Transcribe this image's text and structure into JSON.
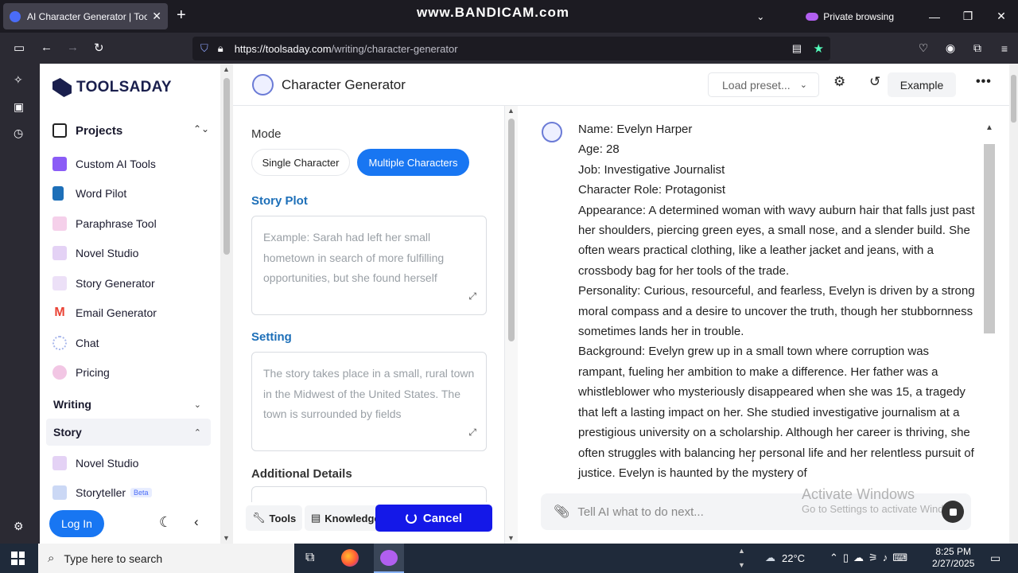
{
  "browser": {
    "tab_title": "AI Character Generator | Toolsaday",
    "tab_close": "✕",
    "new_tab": "+",
    "watermark": "www.BANDICAM.com",
    "private_label": "Private browsing",
    "url_host": "https://toolsaday.com",
    "url_path": "/writing/character-generator"
  },
  "sidebar": {
    "logo": "TOOLSADAY",
    "projects": "Projects",
    "items": [
      {
        "label": "Custom AI Tools",
        "color": "#8b5cf6"
      },
      {
        "label": "Word Pilot",
        "color": "#1d6fb8"
      },
      {
        "label": "Paraphrase Tool",
        "color": "#e9a8d8"
      },
      {
        "label": "Novel Studio",
        "color": "#c4a3e8"
      },
      {
        "label": "Story Generator",
        "color": "#d9c4f0"
      },
      {
        "label": "Email Generator",
        "color": "#ea4335"
      },
      {
        "label": "Chat",
        "color": "#b8c8f0"
      },
      {
        "label": "Pricing",
        "color": "#e58fc6"
      }
    ],
    "section_writing": "Writing",
    "section_story": "Story",
    "story_items": [
      {
        "label": "Novel Studio"
      },
      {
        "label": "Storyteller",
        "badge": "Beta"
      }
    ],
    "login": "Log In"
  },
  "header": {
    "title": "Character Generator",
    "preset": "Load preset...",
    "example": "Example"
  },
  "form": {
    "mode_label": "Mode",
    "mode_single": "Single Character",
    "mode_multiple": "Multiple Characters",
    "mode_selected": "Multiple Characters",
    "plot_label": "Story Plot",
    "plot_placeholder": "Example: Sarah had left her small hometown in search of more fulfilling opportunities, but she found herself",
    "setting_label": "Setting",
    "setting_placeholder": "The story takes place in a small, rural town in the Midwest of the United States. The town is surrounded by fields",
    "details_label": "Additional Details",
    "tools_btn": "Tools",
    "knowledge_btn": "Knowledge",
    "cancel_btn": "Cancel"
  },
  "output": {
    "lines": [
      "Name: Evelyn Harper",
      "Age: 28",
      "Job: Investigative Journalist",
      "Character Role: Protagonist",
      "Appearance: A determined woman with wavy auburn hair that falls just past her shoulders, piercing green eyes, a small nose, and a slender build. She often wears practical clothing, like a leather jacket and jeans, with a crossbody bag for her tools of the trade.",
      "Personality: Curious, resourceful, and fearless, Evelyn is driven by a strong moral compass and a desire to uncover the truth, though her stubbornness sometimes lands her in trouble.",
      "Background: Evelyn grew up in a small town where corruption was rampant, fueling her ambition to make a difference. Her father was a whistleblower who mysteriously disappeared when she was 15, a tragedy that left a lasting impact on her. She studied investigative journalism at a prestigious university on a scholarship. Although her career is thriving, she often struggles with balancing her personal life and her relentless pursuit of justice. Evelyn is haunted by the mystery of"
    ],
    "chat_placeholder": "Tell AI what to do next...",
    "activate_title": "Activate Windows",
    "activate_sub": "Go to Settings to activate Windows."
  },
  "taskbar": {
    "search_placeholder": "Type here to search",
    "temperature": "22°C",
    "time": "8:25 PM",
    "date": "2/27/2025"
  }
}
